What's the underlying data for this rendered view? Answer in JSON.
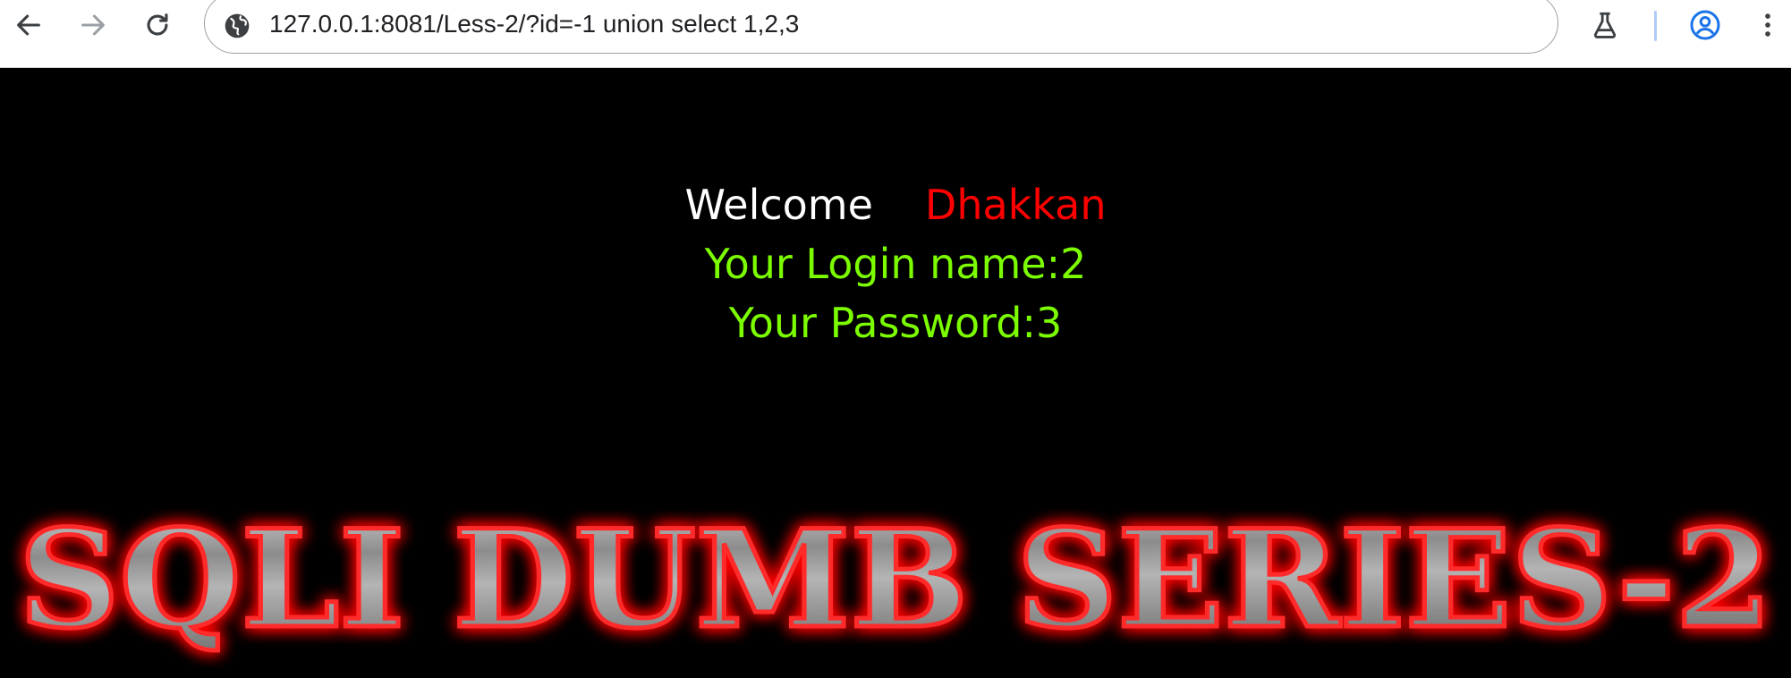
{
  "browser": {
    "url": "127.0.0.1:8081/Less-2/?id=-1 union select 1,2,3",
    "icons": {
      "back": "arrow-left-icon",
      "forward": "arrow-right-icon",
      "reload": "reload-icon",
      "site_info": "globe-icon",
      "labs": "flask-icon",
      "profile": "account-circle-icon",
      "menu": "kebab-menu-icon"
    }
  },
  "page": {
    "welcome_label": "Welcome",
    "welcome_user": "Dhakkan",
    "login_line": "Your Login name:2",
    "password_line": "Your Password:3",
    "banner_title": "SQLI DUMB SERIES-2"
  },
  "colors": {
    "background": "#000000",
    "welcome_text": "#ffffff",
    "user_text": "#ff0000",
    "info_text": "#7cfc00",
    "banner_glow": "#ff0000",
    "banner_metal": "#9a9a9a",
    "profile_icon": "#1a73e8"
  }
}
